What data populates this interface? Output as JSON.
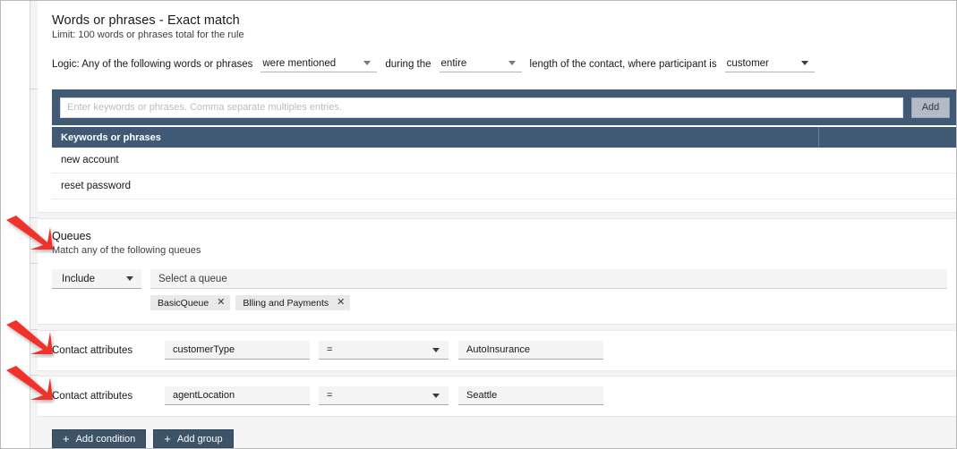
{
  "words_section": {
    "title": "Words or phrases - Exact match",
    "subtitle": "Limit: 100 words or phrases total for the rule",
    "logic": {
      "prefix_label": "Logic: Any of the following words or phrases",
      "condition_value": "were mentioned",
      "mid_label": "during the",
      "duration_value": "entire",
      "suffix_label": "length of the contact, where participant is",
      "participant_value": "customer"
    },
    "keyword_input_placeholder": "Enter keywords or phrases. Comma separate multiples entries.",
    "keyword_input_value": "",
    "add_button_label": "Add",
    "table": {
      "columns": [
        "Keywords or phrases",
        ""
      ],
      "rows": [
        [
          "new account",
          ""
        ],
        [
          "reset password",
          ""
        ]
      ]
    }
  },
  "queues_section": {
    "title": "Queues",
    "subtitle": "Match any of the following queues",
    "include_value": "Include",
    "select_placeholder": "Select a queue",
    "tags": [
      {
        "label": "BasicQueue",
        "remove": "✕"
      },
      {
        "label": "Blling and Payments",
        "remove": "✕"
      }
    ]
  },
  "contact_attributes": [
    {
      "label": "Contact attributes",
      "key": "customerType",
      "operator": "=",
      "value": "AutoInsurance"
    },
    {
      "label": "Contact attributes",
      "key": "agentLocation",
      "operator": "=",
      "value": "Seattle"
    }
  ],
  "footer": {
    "add_condition_label": "Add condition",
    "add_group_label": "Add group",
    "plus_glyph": "+"
  },
  "colors": {
    "panel_blue": "#405a75",
    "button_dark": "#3d5368",
    "annotation_red": "#f0302c",
    "field_grey": "#f4f4f4",
    "tag_grey": "#e9e9e9"
  }
}
